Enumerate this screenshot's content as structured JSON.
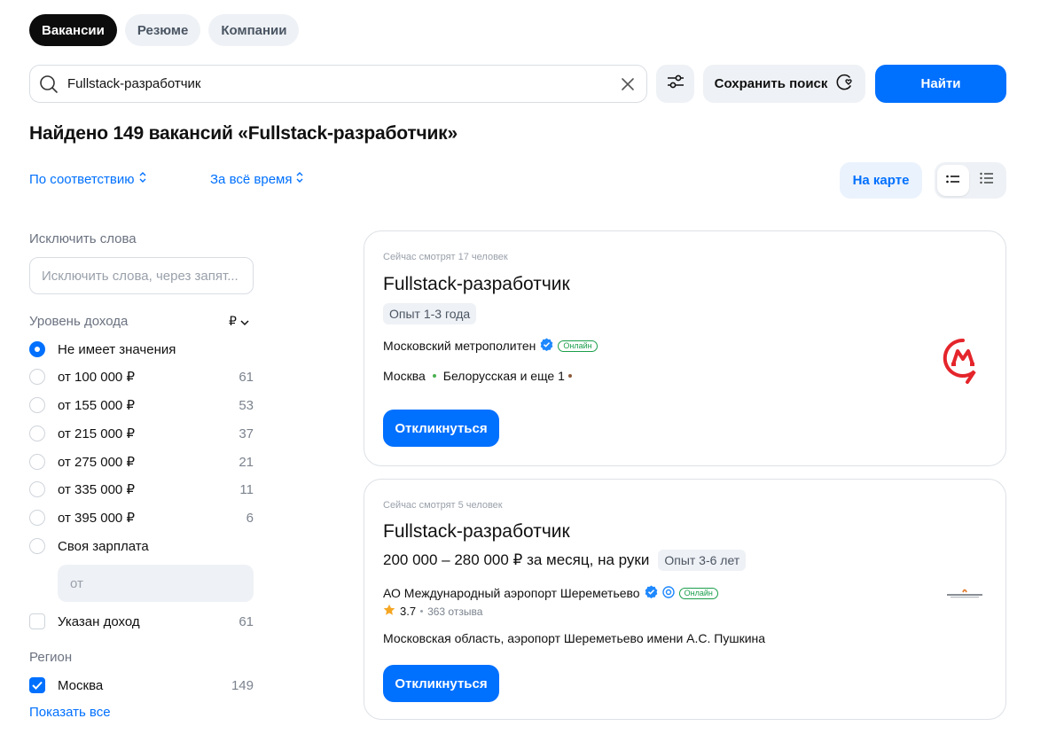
{
  "tabs": [
    {
      "label": "Вакансии",
      "active": true
    },
    {
      "label": "Резюме",
      "active": false
    },
    {
      "label": "Компании",
      "active": false
    }
  ],
  "search": {
    "value": "Fullstack-разработчик",
    "save_label": "Сохранить поиск",
    "find_label": "Найти"
  },
  "results_title": "Найдено 149 вакансий «Fullstack-разработчик»",
  "sort": {
    "relevance": "По соответствию",
    "period": "За всё время"
  },
  "map_label": "На карте",
  "sidebar": {
    "exclude_label": "Исключить слова",
    "exclude_placeholder": "Исключить слова, через запят...",
    "income_label": "Уровень дохода",
    "currency": "₽",
    "income_options": [
      {
        "label": "Не имеет значения",
        "count": "",
        "selected": true
      },
      {
        "label": "от 100 000 ₽",
        "count": "61",
        "selected": false
      },
      {
        "label": "от 155 000 ₽",
        "count": "53",
        "selected": false
      },
      {
        "label": "от 215 000 ₽",
        "count": "37",
        "selected": false
      },
      {
        "label": "от 275 000 ₽",
        "count": "21",
        "selected": false
      },
      {
        "label": "от 335 000 ₽",
        "count": "11",
        "selected": false
      },
      {
        "label": "от 395 000 ₽",
        "count": "6",
        "selected": false
      },
      {
        "label": "Своя зарплата",
        "count": "",
        "selected": false
      }
    ],
    "salary_placeholder": "от",
    "income_specified": {
      "label": "Указан доход",
      "count": "61",
      "checked": false
    },
    "region_label": "Регион",
    "region": {
      "label": "Москва",
      "count": "149",
      "checked": true
    },
    "show_all": "Показать все"
  },
  "vacancies": [
    {
      "viewers": "Сейчас смотрят 17 человек",
      "title": "Fullstack-разработчик",
      "experience": "Опыт 1-3 года",
      "company": "Московский метрополитен",
      "online": "Онлайн",
      "city": "Москва",
      "metro": "Белорусская и еще 1",
      "apply": "Откликнуться",
      "logo": "moscow-metro-logo",
      "metro_color": "#4caf50",
      "metro_color2": "#8d5b3c"
    },
    {
      "viewers": "Сейчас смотрят 5 человек",
      "title": "Fullstack-разработчик",
      "salary": "200 000 – 280 000 ₽ за месяц, на руки",
      "experience": "Опыт 3-6 лет",
      "company": "АО Международный аэропорт Шереметьево",
      "online": "Онлайн",
      "rating": "3.7",
      "reviews": "363 отзыва",
      "address": "Московская область, аэропорт Шереметьево имени А.С. Пушкина",
      "apply": "Откликнуться",
      "logo": "sheremetyevo-logo"
    }
  ],
  "colors": {
    "accent": "#0070ff",
    "metro_red": "#e4252b"
  }
}
